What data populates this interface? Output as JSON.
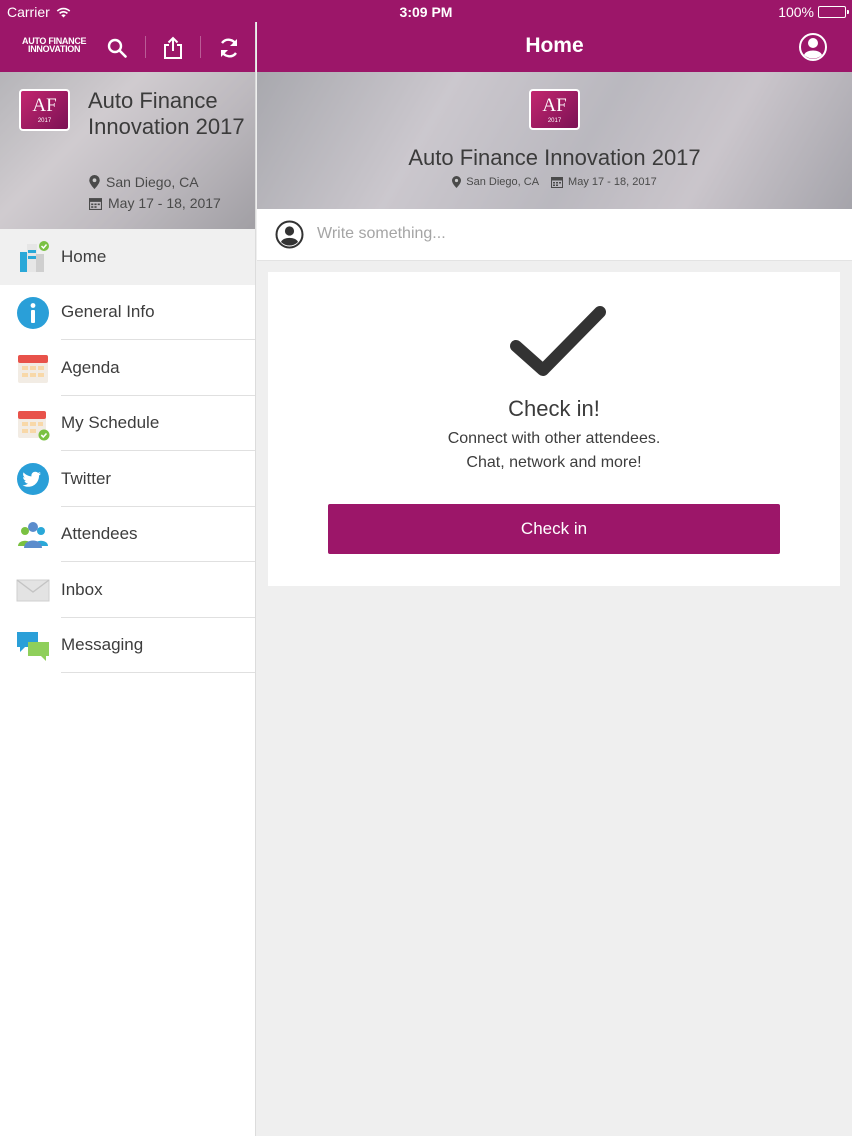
{
  "status_bar": {
    "carrier": "Carrier",
    "time": "3:09 PM",
    "battery": "100%",
    "battery_level": 1.0
  },
  "sidebar": {
    "logo_line1": "AUTO FINANCE",
    "logo_line2": "INNOVATION",
    "event": {
      "badge_text": "AF",
      "badge_year": "2017",
      "title": "Auto Finance Innovation 2017",
      "location": "San Diego, CA",
      "dates": "May 17 - 18, 2017"
    },
    "items": [
      {
        "label": "Home",
        "icon": "home-icon",
        "active": true
      },
      {
        "label": "General Info",
        "icon": "info-icon"
      },
      {
        "label": "Agenda",
        "icon": "calendar-icon"
      },
      {
        "label": "My Schedule",
        "icon": "calendar-check-icon"
      },
      {
        "label": "Twitter",
        "icon": "twitter-icon"
      },
      {
        "label": "Attendees",
        "icon": "attendees-icon"
      },
      {
        "label": "Inbox",
        "icon": "envelope-icon"
      },
      {
        "label": "Messaging",
        "icon": "chat-bubbles-icon"
      }
    ]
  },
  "main": {
    "nav_title": "Home",
    "hero": {
      "badge_text": "AF",
      "badge_year": "2017",
      "title": "Auto Finance Innovation 2017",
      "location": "San Diego, CA",
      "dates": "May 17 - 18, 2017"
    },
    "compose_placeholder": "Write something...",
    "checkin_card": {
      "heading": "Check in!",
      "line1": "Connect with other attendees.",
      "line2": "Chat, network and more!",
      "button_label": "Check in"
    }
  },
  "colors": {
    "brand": "#9c1669",
    "background": "#efefef"
  }
}
